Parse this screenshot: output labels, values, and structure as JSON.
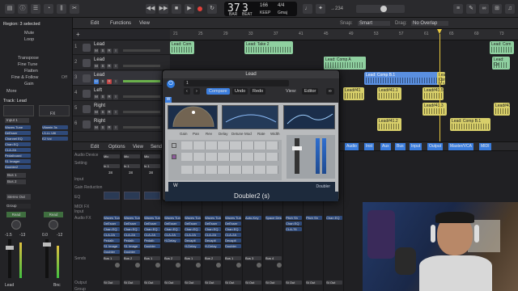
{
  "transport": {
    "bars": "37",
    "beats": "3",
    "tempo": "166",
    "tempo_label": "KEEP",
    "time_sig": "4/4",
    "key": "Gmaj",
    "bar_label": "BAR",
    "beat_label": "BEAT",
    "counter": "→234",
    "snap_label": "Snap:",
    "snap_value": "Smart",
    "drag_label": "Drag:",
    "drag_value": "No Overlap"
  },
  "inspector": {
    "region_header": "Region: 3 selected",
    "rows": [
      "Mute",
      "Loop",
      "Transpose",
      "Fine Tune",
      "Flatten",
      "Fine & Follow",
      "Gain",
      "More"
    ],
    "off_value": "Off",
    "track_header": "Track: Lead",
    "input_label": "Input 1",
    "channel_name": "Lead",
    "fx_label": "FX",
    "plugins_a": [
      "Waves Tune",
      "DeEsser",
      "Channel EQ",
      "Chan EQ",
      "CLA-2A",
      "Pedalboard",
      "S1 Imager",
      "Doubler2"
    ],
    "plugins_b": [
      "Vitamin 3s",
      "L3-LL Ulti",
      "E2 Vol"
    ],
    "bus_a": "Bus 1",
    "bus_b": "Bus 2",
    "output_label": "Stereo Out",
    "group_label": "Group",
    "read_a": "Read",
    "read_b": "Read",
    "vol_a": "-1.5",
    "vol_b": "-13",
    "vol_c": "0.0",
    "vol_d": "-12",
    "bottom_a": "Lead",
    "bottom_b": "Bnc"
  },
  "menubar": {
    "edit": "Edit",
    "functions": "Functions",
    "view": "View"
  },
  "tracks": [
    {
      "num": "1",
      "name": "Lead"
    },
    {
      "num": "2",
      "name": "Lead"
    },
    {
      "num": "3",
      "name": "Lead"
    },
    {
      "num": "4",
      "name": "Left"
    },
    {
      "num": "5",
      "name": "Right"
    },
    {
      "num": "6",
      "name": "Right"
    }
  ],
  "ruler": [
    "21",
    "25",
    "29",
    "33",
    "37",
    "41",
    "45",
    "49",
    "53",
    "57",
    "61",
    "65",
    "69",
    "73"
  ],
  "regions": [
    {
      "label": "Lead: Com"
    },
    {
      "label": "Lead: Take 2"
    },
    {
      "label": "Lead: Com"
    },
    {
      "label": "Lead: Comp A"
    },
    {
      "label": "Lead: Comp A"
    },
    {
      "label": "Lead: Comp A"
    },
    {
      "label": "Lead: Comp A"
    },
    {
      "label": "Lead: Co"
    },
    {
      "label": "Lead: Comp B.1"
    },
    {
      "label": "Lead: Comp B.1"
    },
    {
      "label": "Lead#41"
    },
    {
      "label": "Lead#41.1"
    },
    {
      "label": "Lead#41.5"
    },
    {
      "label": "Lead#41.11"
    },
    {
      "label": "Lead: Comp B.1"
    },
    {
      "label": "Lead#41.2"
    },
    {
      "label": "Lead#41.3"
    },
    {
      "label": "Lead#41.4"
    }
  ],
  "mixer_bar": {
    "edit": "Edit",
    "options": "Options",
    "view": "View",
    "sends": "Sends",
    "filters": [
      "Audio",
      "Inst",
      "Aux",
      "Bus",
      "Input",
      "Output",
      "Master/VCA",
      "MIDI"
    ]
  },
  "mixer": {
    "row_labels": [
      "Audio Device",
      "Input",
      "Setting",
      "Gain Reduction",
      "EQ",
      "MIDI FX",
      "Input",
      "Audio FX",
      "Sends",
      "Output",
      "Group"
    ],
    "strips": [
      {
        "name": "Mic",
        "input": "In 1",
        "val": "38",
        "fx": [
          "Waves Tune",
          "DeEsser",
          "Chan EQ",
          "CLA-2A",
          "Pedalb",
          "S1 Image",
          "Doubler"
        ],
        "send": "Bus 1",
        "out": "St Out"
      },
      {
        "name": "Mic",
        "input": "In 1",
        "val": "38",
        "fx": [
          "Waves Tune",
          "DeEsser",
          "Chan EQ",
          "CLA-2A",
          "Pedalb",
          "S1 Image",
          "Doubler"
        ],
        "send": "Bus 2",
        "out": "St Out"
      },
      {
        "name": "Mic",
        "input": "In 1",
        "val": "38",
        "fx": [
          "Waves Tune",
          "DeEsser",
          "Chan EQ",
          "CLA-2A",
          "Pedalb",
          "Doubler"
        ],
        "send": "Bus 1",
        "out": "St Out"
      },
      {
        "name": "Mic",
        "input": "In 1",
        "val": "38",
        "fx": [
          "Waves Tune",
          "DeEsser",
          "Chan EQ",
          "CLA-2A",
          "H-Delay"
        ],
        "send": "Bus 2",
        "out": "St Out"
      },
      {
        "name": "Mic",
        "input": "In 1",
        "val": "38",
        "fx": [
          "Waves Tune",
          "DeEsser",
          "Chan EQ",
          "CLA-2A",
          "Decapit",
          "H-Delay"
        ],
        "send": "Bus 1",
        "out": "St Out"
      },
      {
        "name": "Mic",
        "input": "In 1",
        "val": "38",
        "fx": [
          "Waves Tune",
          "DeEsser",
          "Chan EQ",
          "CLA-2A",
          "Decapit",
          "H-Delay"
        ],
        "send": "Bus 2",
        "out": "St Out"
      },
      {
        "name": "Mic",
        "input": "In 1",
        "val": "38",
        "fx": [
          "Waves Tune",
          "DeEsser",
          "Chan EQ",
          "CLA-2A",
          "Decapit",
          "Doubler"
        ],
        "send": "Bus 1",
        "out": "St Out"
      },
      {
        "name": "",
        "input": "",
        "val": "",
        "fx": [
          "Auto-Key"
        ],
        "send": "Bus 3",
        "out": "St Out"
      },
      {
        "name": "",
        "input": "",
        "val": "",
        "fx": [
          "Space Desig"
        ],
        "send": "Bus 4",
        "out": "St Out"
      },
      {
        "name": "",
        "input": "",
        "val": "",
        "fx": [
          "Pitch Sh",
          "Chan EQ",
          "CLA-76"
        ],
        "send": "",
        "out": "St Out"
      },
      {
        "name": "",
        "input": "",
        "val": "",
        "fx": [
          "Pitch Sh"
        ],
        "send": "",
        "out": "St Out"
      },
      {
        "name": "",
        "input": "",
        "val": "",
        "fx": [
          "Chan EQ"
        ],
        "send": "",
        "out": "St Out"
      }
    ]
  },
  "plugin": {
    "title": "Lead",
    "preset": "1",
    "compare": "Compare",
    "undo": "Undo",
    "redo": "Redo",
    "view_label": "View:",
    "view_value": "Editor",
    "waves_logo": "W",
    "knob_labels": [
      "Gain",
      "Pan",
      "Rev",
      "Delay",
      "Detune",
      "Mod",
      "Rate",
      "Width"
    ],
    "footer": "Doubler2 (s)",
    "brand": "Doubler"
  },
  "colors": {
    "region_green": "#8fd0a0",
    "region_yellow": "#d8cf6a",
    "region_selected": "#5a8fe0",
    "accent_blue": "#3b7ddd"
  }
}
